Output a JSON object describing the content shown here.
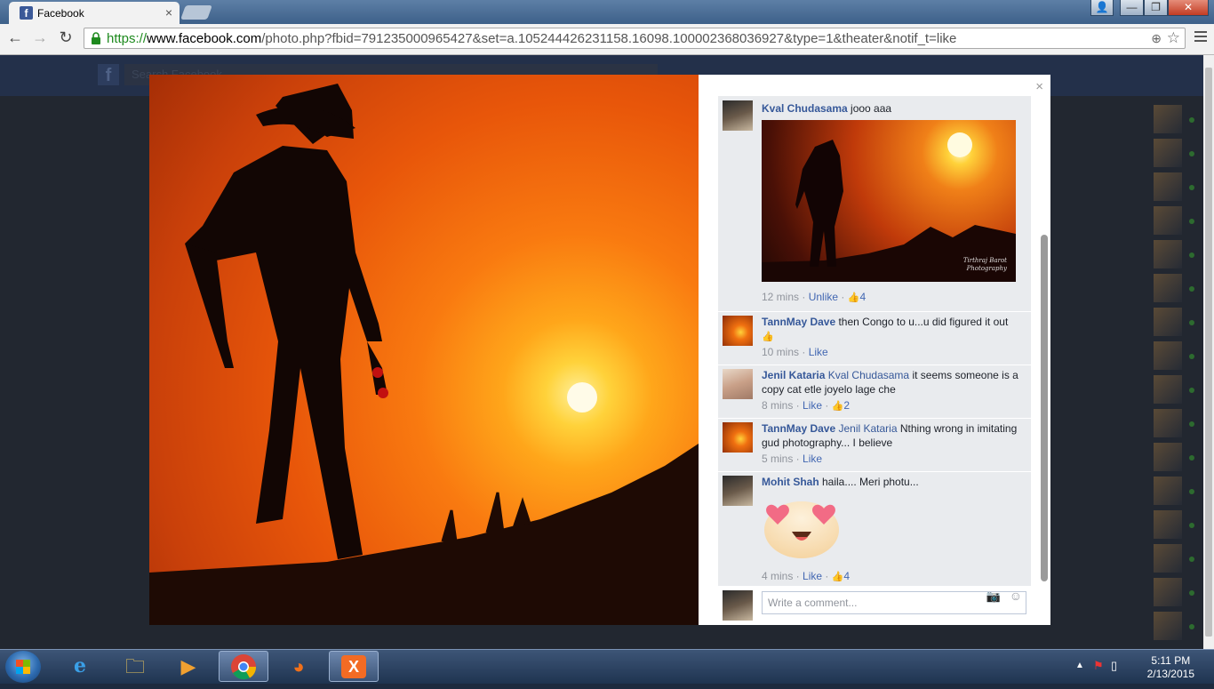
{
  "browser": {
    "tab_title": "Facebook",
    "tab_close": "×",
    "url_scheme": "https://",
    "url_host": "www.facebook.com",
    "url_path": "/photo.php?fbid=791235000965427&set=a.105244426231158.16098.100002368036927&type=1&theater&notif_t=like",
    "back": "←",
    "forward": "→",
    "reload": "↻",
    "min": "—",
    "max": "❐",
    "close": "✕",
    "user": "👤"
  },
  "page": {
    "fb_logo": "f",
    "search_placeholder": "Search Facebook"
  },
  "viewer": {
    "close": "×",
    "comments": [
      {
        "name": "Kval Chudasama",
        "text": " jooo aaa",
        "time": "12 mins",
        "action": "Unlike",
        "likes": "4",
        "watermark_line1": "Tirthraj Barot",
        "watermark_line2": "Photography"
      },
      {
        "name": "TannMay Dave",
        "text": " then Congo to u...u did figured it out ",
        "time": "10 mins",
        "action": "Like"
      },
      {
        "name": "Jenil Kataria",
        "tag": "Kval Chudasama",
        "text": " it seems someone is a copy cat etle joyelo lage che",
        "time": "8 mins",
        "action": "Like",
        "likes": "2"
      },
      {
        "name": "TannMay Dave",
        "tag": "Jenil Kataria",
        "text": " Nthing wrong in imitating gud photography... I believe",
        "time": "5 mins",
        "action": "Like"
      },
      {
        "name": "Mohit Shah",
        "text": " haila.... Meri photu...",
        "time": "4 mins",
        "action": "Like",
        "likes": "4"
      }
    ],
    "separator": " · ",
    "comment_placeholder": "Write a comment..."
  },
  "taskbar": {
    "time": "5:11 PM",
    "date": "2/13/2015"
  },
  "colors": {
    "fb_blue": "#3b5998",
    "link": "#365899",
    "meta": "#90949c"
  }
}
